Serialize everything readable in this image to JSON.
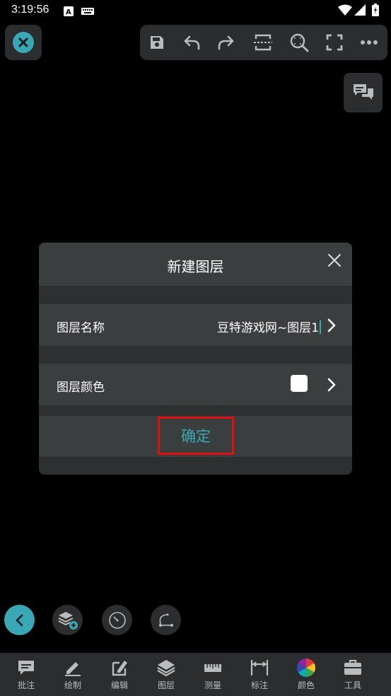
{
  "status_bar": {
    "time": "3:19:56"
  },
  "toolbar": {
    "icons": [
      "save-icon",
      "undo-icon",
      "redo-icon",
      "crop-fit-icon",
      "zoom-search-icon",
      "fullscreen-icon",
      "more-icon"
    ]
  },
  "dialog": {
    "title": "新建图层",
    "layer_name_label": "图层名称",
    "layer_name_value": "豆特游戏网~图层1",
    "layer_color_label": "图层颜色",
    "layer_color_value": "#ffffff",
    "confirm_label": "确定"
  },
  "colors": {
    "accent": "#3aa7b5",
    "highlight": "#e01010",
    "panel": "#2b2d2f",
    "row": "#3b3e3f"
  },
  "bottom_nav": {
    "items": [
      {
        "label": "批注",
        "icon": "comment-icon"
      },
      {
        "label": "绘制",
        "icon": "pencil-icon"
      },
      {
        "label": "编辑",
        "icon": "edit-icon"
      },
      {
        "label": "图层",
        "icon": "layers-icon"
      },
      {
        "label": "测量",
        "icon": "ruler-icon"
      },
      {
        "label": "标注",
        "icon": "dimension-icon"
      },
      {
        "label": "颜色",
        "icon": "color-wheel-icon"
      },
      {
        "label": "工具",
        "icon": "toolbox-icon"
      }
    ]
  }
}
